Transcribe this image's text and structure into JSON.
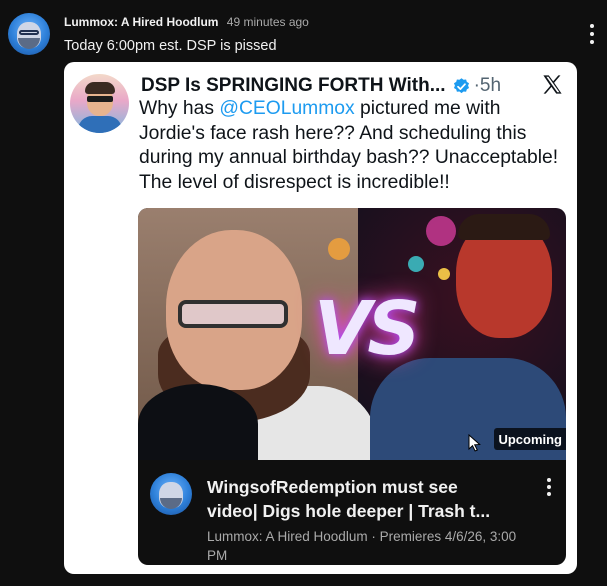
{
  "post": {
    "author": "Lummox: A Hired Hoodlum",
    "time": "49 minutes ago",
    "text": "Today 6:00pm est. DSP is pissed"
  },
  "tweet": {
    "name": "DSP Is SPRINGING FORTH With...",
    "separator": "·",
    "ago": "5h",
    "body_pre": "Why has ",
    "mention": "@CEOLummox",
    "body_post": " pictured me with Jordie's face rash here?? And scheduling this during my annual birthday bash?? Unacceptable! The level of disrespect is incredible!!",
    "verified_color": "#1d9bf0"
  },
  "video": {
    "badge": "Upcoming",
    "thumb_text": "VS",
    "title_line1": "WingsofRedemption must see",
    "title_line2": "video| Digs hole deeper | Trash t...",
    "meta": "Lummox: A Hired Hoodlum · Premieres 4/6/26, 3:00 PM"
  },
  "icons": [
    "avatar",
    "kebab-menu-icon",
    "verified-badge-icon",
    "x-logo-icon",
    "cursor-icon"
  ],
  "colors": {
    "background": "#0f0f0f",
    "card": "#ffffff",
    "mention": "#1d9bf0",
    "secondary_text": "#aaaaaa"
  }
}
